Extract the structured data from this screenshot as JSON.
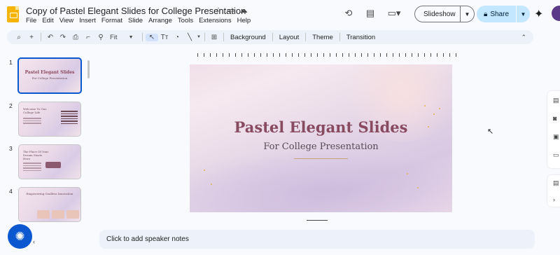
{
  "header": {
    "doc_title": "Copy of Pastel Elegant Slides for College Presentation",
    "menu": [
      "File",
      "Edit",
      "View",
      "Insert",
      "Format",
      "Slide",
      "Arrange",
      "Tools",
      "Extensions",
      "Help"
    ],
    "slideshow_label": "Slideshow",
    "share_label": "Share"
  },
  "toolbar": {
    "zoom": "Fit",
    "background": "Background",
    "layout": "Layout",
    "theme": "Theme",
    "transition": "Transition"
  },
  "filmstrip": {
    "slides": [
      {
        "number": "1",
        "title": "Pastel Elegant Slides",
        "subtitle": "For College Presentation"
      },
      {
        "number": "2",
        "title": "Welcome To Our College Life"
      },
      {
        "number": "3",
        "title": "The Place Of Your Dream Starts Here"
      },
      {
        "number": "4",
        "title": "Empowering Goalless Innovation"
      }
    ]
  },
  "slide": {
    "title": "Pastel Elegant Slides",
    "subtitle": "For College Presentation"
  },
  "notes": {
    "placeholder": "Click to add speaker notes"
  },
  "colors": {
    "accent": "#0b57d0",
    "share_bg": "#c2e7ff",
    "slide_title": "#874a5f"
  }
}
